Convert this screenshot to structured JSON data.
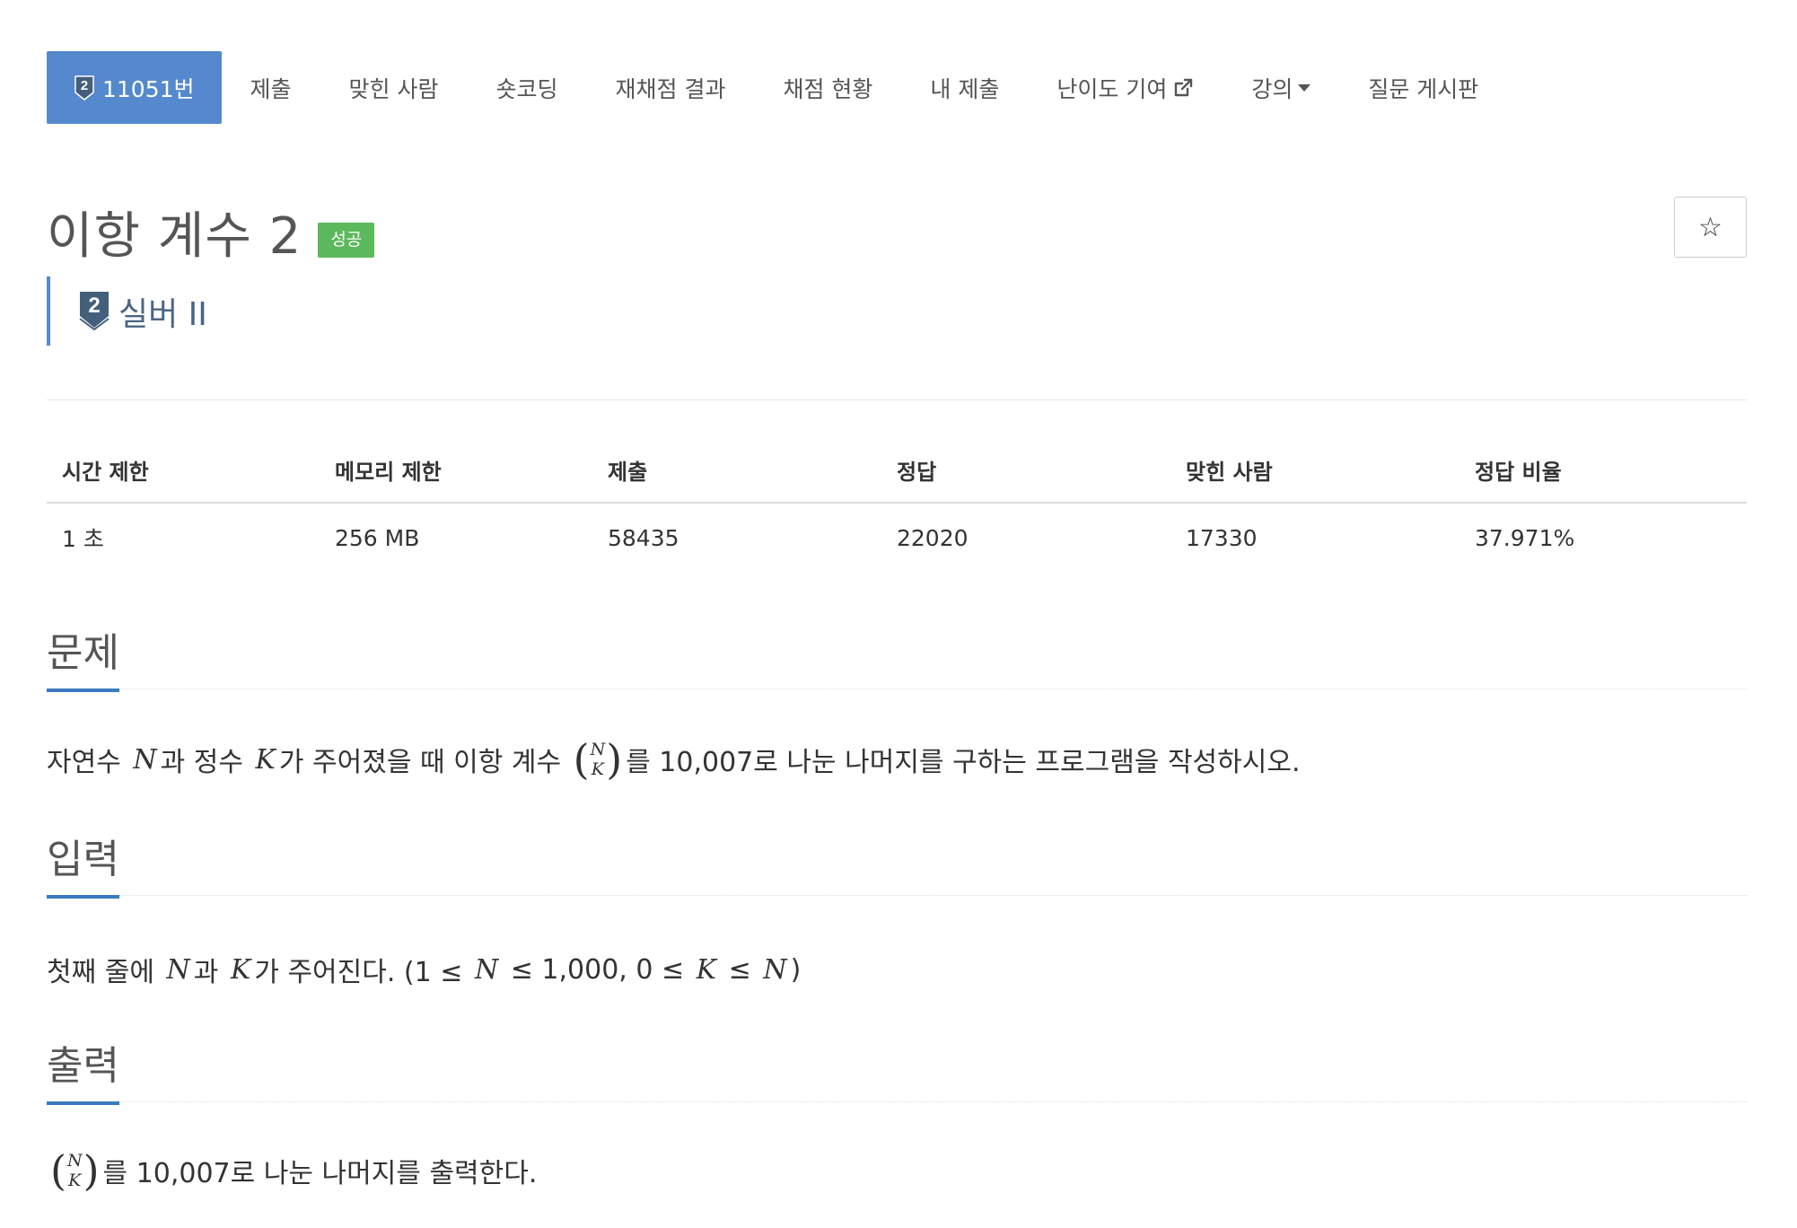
{
  "nav": {
    "tabs": [
      {
        "label": "11051번",
        "active": true
      },
      {
        "label": "제출"
      },
      {
        "label": "맞힌 사람"
      },
      {
        "label": "숏코딩"
      },
      {
        "label": "재채점 결과"
      },
      {
        "label": "채점 현황"
      },
      {
        "label": "내 제출"
      },
      {
        "label": "난이도 기여",
        "icon": "external-link-icon"
      },
      {
        "label": "강의",
        "icon": "caret-down-icon"
      },
      {
        "label": "질문 게시판"
      }
    ],
    "tier_digit": "2"
  },
  "problem": {
    "title": "이항 계수 2",
    "result_badge": "성공",
    "star_symbol": "☆",
    "tier": {
      "digit": "2",
      "label": "실버 II"
    }
  },
  "info": {
    "headers": [
      "시간 제한",
      "메모리 제한",
      "제출",
      "정답",
      "맞힌 사람",
      "정답 비율"
    ],
    "values": [
      "1 초",
      "256 MB",
      "58435",
      "22020",
      "17330",
      "37.971%"
    ]
  },
  "sections": {
    "problem": {
      "title": "문제",
      "t1": "자연수",
      "N": "N",
      "t2": "과 정수",
      "K": "K",
      "t3": "가 주어졌을 때 이항 계수",
      "t4": "를 10,007로 나눈 나머지를 구하는 프로그램을 작성하시오."
    },
    "input": {
      "title": "입력",
      "t1": "첫째 줄에",
      "N": "N",
      "t2": "과",
      "K": "K",
      "t3": "가 주어진다. (1 ≤",
      "N2": "N",
      "t4": "≤ 1,000, 0 ≤",
      "K2": "K",
      "t5": "≤",
      "N3": "N",
      "t6": ")"
    },
    "output": {
      "title": "출력",
      "t1": "를 10,007로 나눈 나머지를 출력한다."
    }
  },
  "colors": {
    "accent": "#5589cd",
    "success": "#5cb85c",
    "tier_silver": "#435f7a"
  }
}
